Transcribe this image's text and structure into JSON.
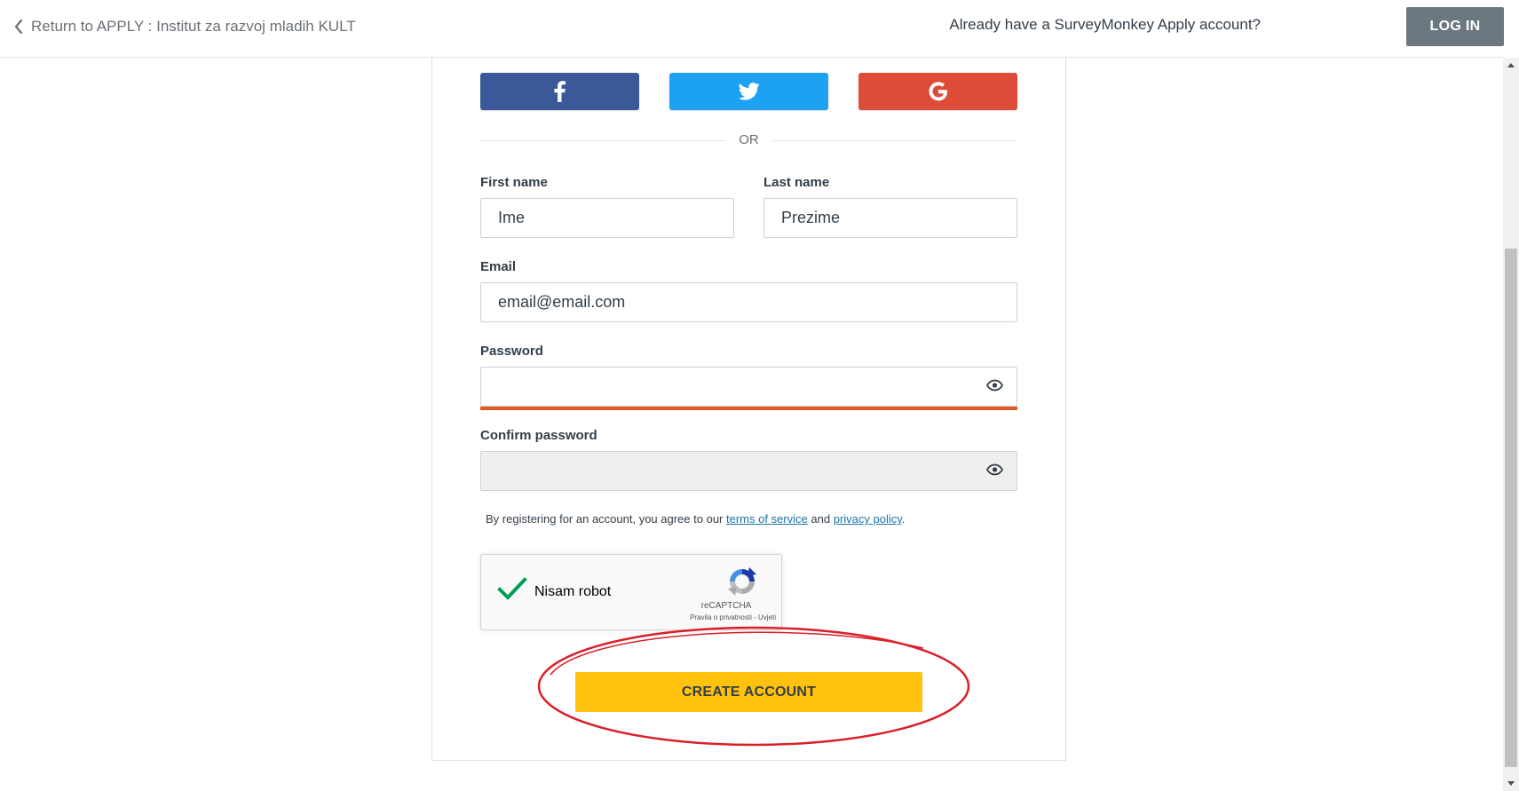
{
  "header": {
    "back_link": "Return to APPLY : Institut za razvoj mladih KULT",
    "already_text": "Already have a SurveyMonkey Apply account?",
    "login_label": "LOG IN"
  },
  "social": {
    "facebook_icon": "facebook-f-icon",
    "twitter_icon": "twitter-bird-icon",
    "google_icon": "google-g-icon",
    "colors": {
      "facebook": "#3b5998",
      "twitter": "#1da1f2",
      "google": "#dd4b39"
    }
  },
  "divider": {
    "or": "OR"
  },
  "form": {
    "first_name": {
      "label": "First name",
      "placeholder": "Ime"
    },
    "last_name": {
      "label": "Last name",
      "placeholder": "Prezime"
    },
    "email": {
      "label": "Email",
      "placeholder": "email@email.com"
    },
    "password": {
      "label": "Password",
      "value": ""
    },
    "confirm_password": {
      "label": "Confirm password",
      "value": ""
    }
  },
  "terms": {
    "prefix": "By registering for an account, you agree to our",
    "terms_link": "terms of service",
    "and": "and",
    "privacy_link": "privacy policy",
    "suffix": "."
  },
  "captcha": {
    "label": "Nisam robot",
    "checked": true,
    "brand": "reCAPTCHA",
    "privacy": "Pravila o privatnosti",
    "separator": " - ",
    "terms": "Uvjeti"
  },
  "create_account_label": "CREATE ACCOUNT",
  "colors": {
    "accent_yellow": "#ffc20e",
    "password_strength_bar": "#e55a24",
    "annotation_circle": "#d9202a",
    "login_button": "#6b787f"
  }
}
